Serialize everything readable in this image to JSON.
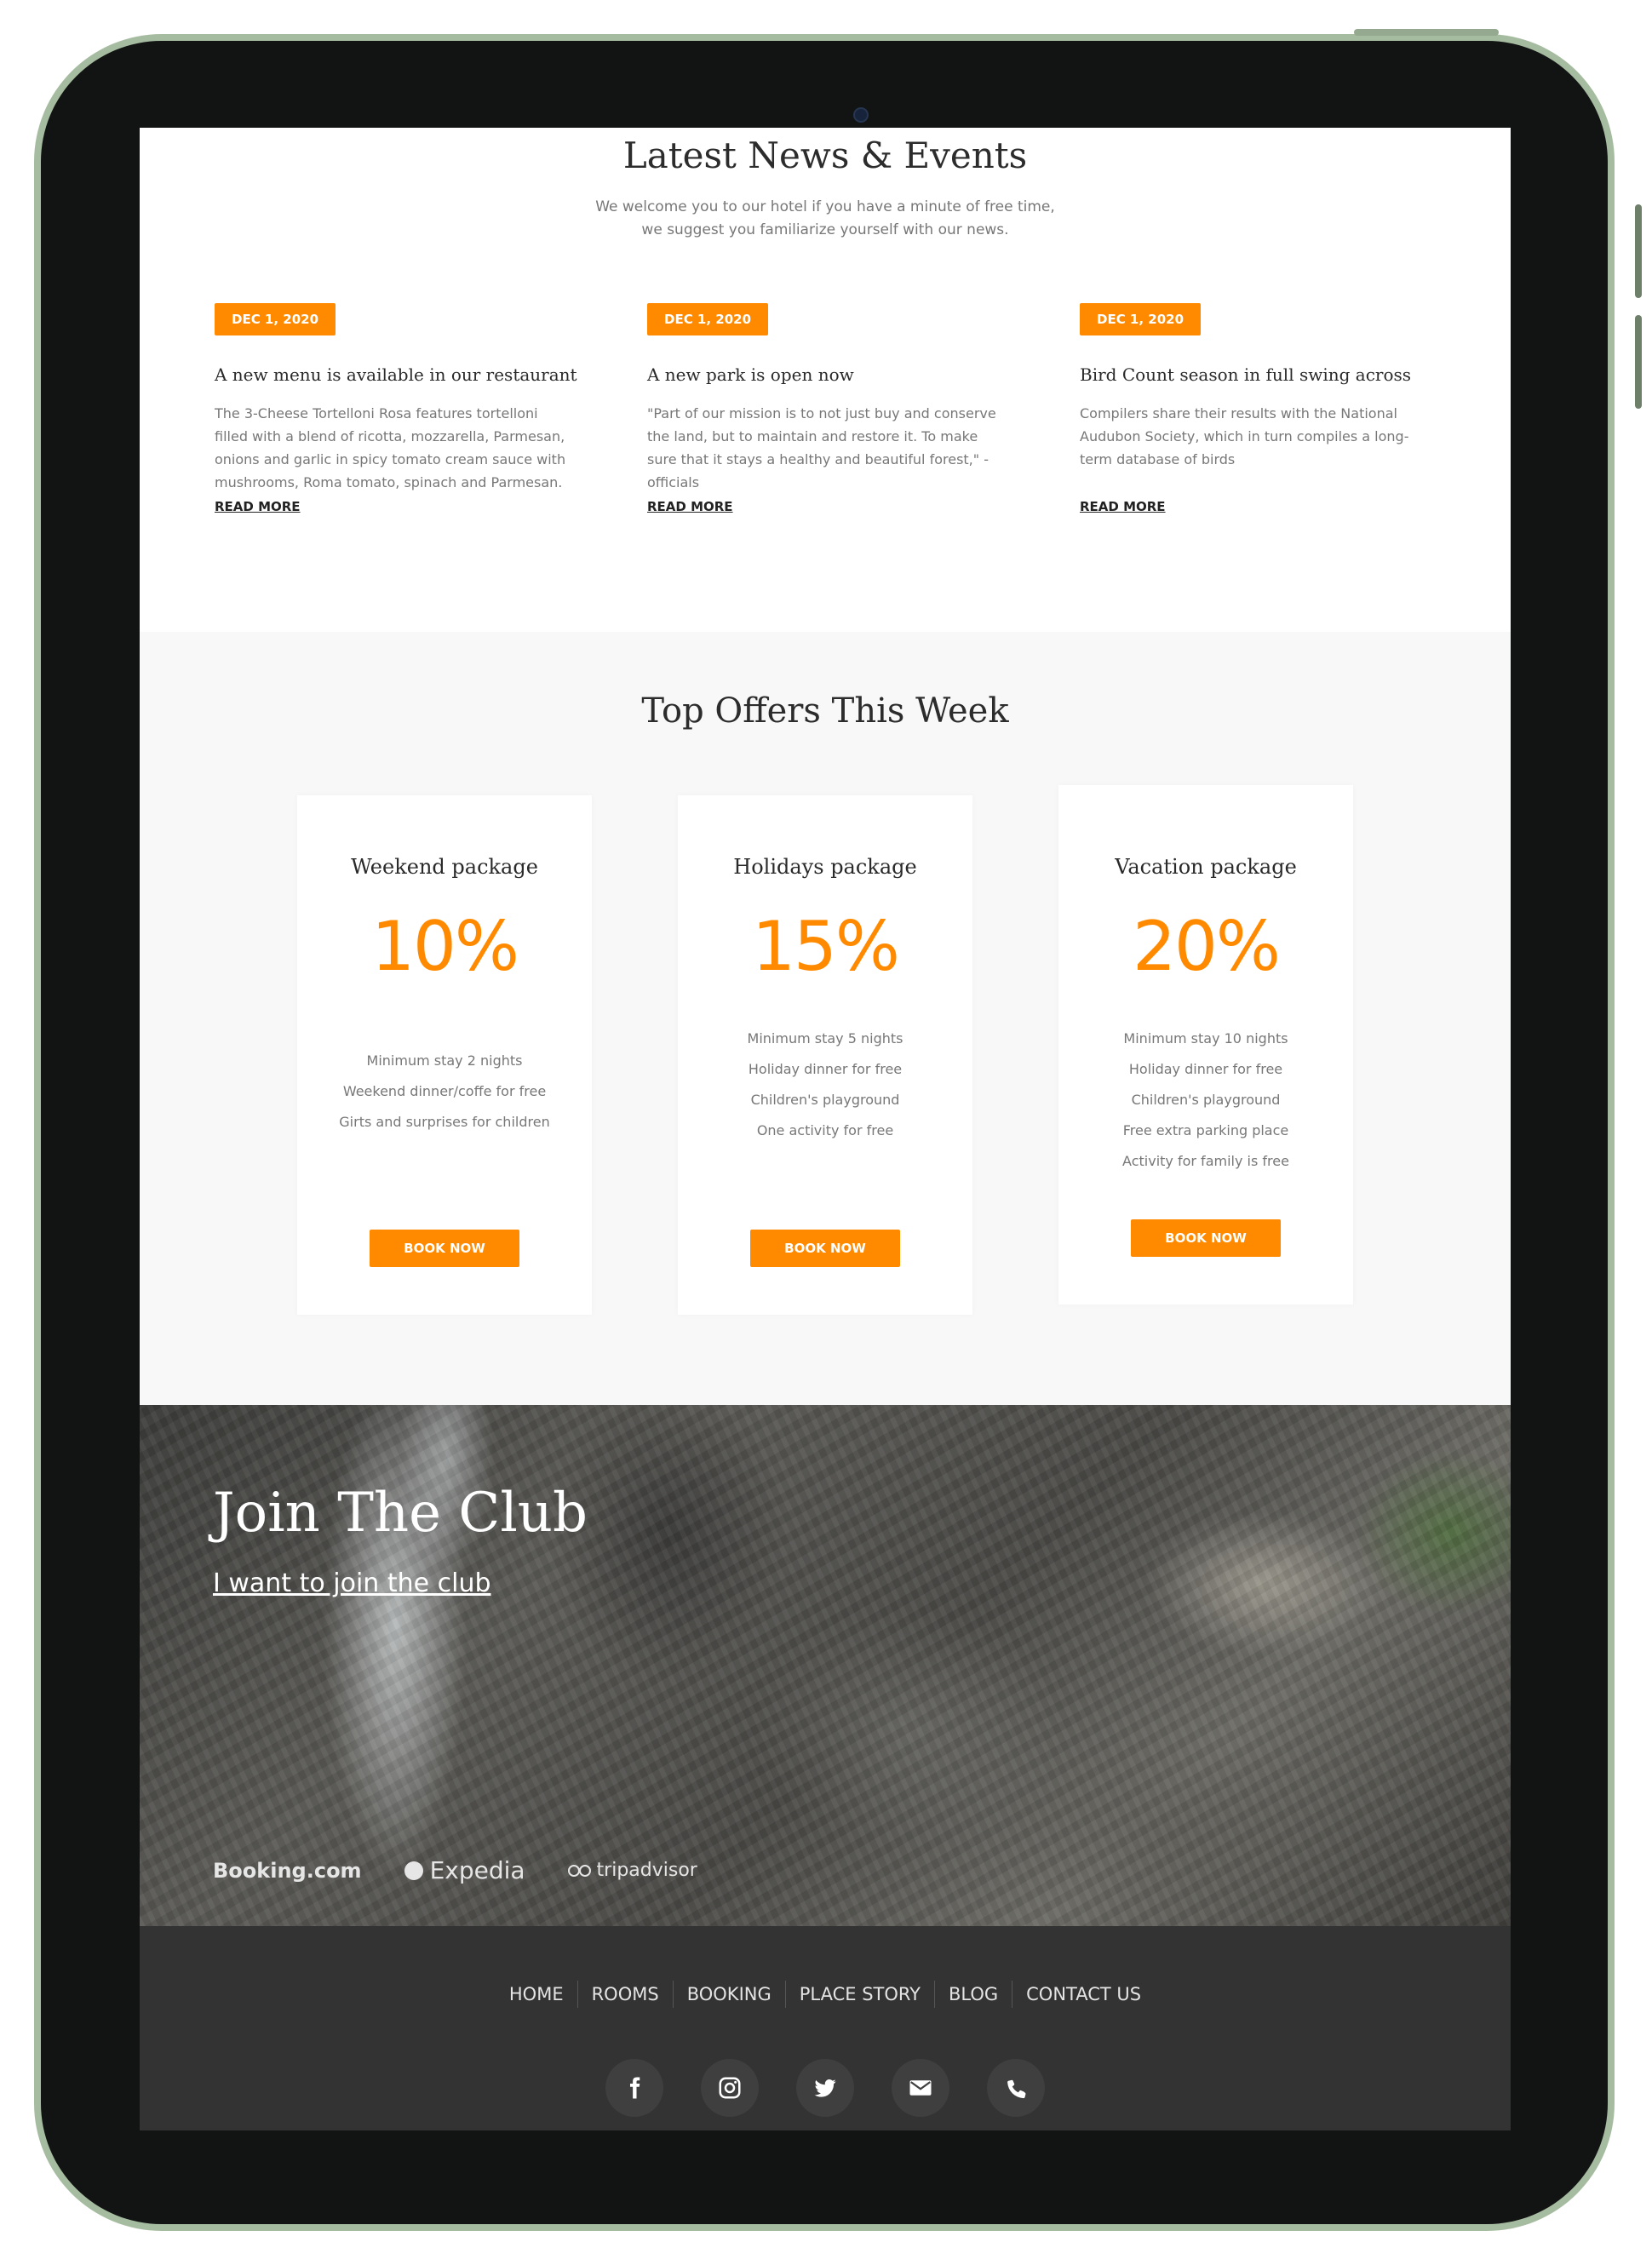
{
  "news": {
    "title": "Latest News & Events",
    "subtitle": "We welcome you to our hotel if you have a minute of free time, we suggest you familiarize yourself with our news.",
    "items": [
      {
        "date": "DEC 1, 2020",
        "headline": "A new menu is available in our restaurant",
        "body": "The 3-Cheese Tortelloni Rosa features tortelloni filled with a blend of ricotta, mozzarella, Parmesan, onions and garlic in spicy tomato cream sauce with mushrooms, Roma tomato, spinach and Parmesan.",
        "read_more": "READ MORE"
      },
      {
        "date": "DEC 1, 2020",
        "headline": "A new park is open now",
        "body": "\"Part of our mission is to not just buy and conserve the land, but to maintain and restore it. To make sure that it stays a healthy and beautiful forest,\" - officials",
        "read_more": "READ MORE"
      },
      {
        "date": "DEC 1, 2020",
        "headline": "Bird Count season in full swing across",
        "body": "Compilers share their results with the National Audubon Society, which in turn compiles a long-term database of birds",
        "read_more": "READ MORE"
      }
    ]
  },
  "offers": {
    "title": "Top Offers This Week",
    "cards": [
      {
        "title": "Weekend package",
        "percent": "10%",
        "features": [
          "Minimum stay 2 nights",
          "Weekend dinner/coffe for free",
          "Girts and surprises for children"
        ],
        "button": "BOOK NOW"
      },
      {
        "title": "Holidays package",
        "percent": "15%",
        "features": [
          "Minimum stay 5 nights",
          "Holiday dinner for free",
          "Children's playground",
          "One activity for free"
        ],
        "button": "BOOK NOW"
      },
      {
        "title": "Vacation package",
        "percent": "20%",
        "features": [
          "Minimum stay 10 nights",
          "Holiday dinner for free",
          "Children's playground",
          "Free extra parking place",
          "Activity for family is free"
        ],
        "button": "BOOK NOW"
      }
    ]
  },
  "club": {
    "title": "Join The Club",
    "link": "I want to join the club",
    "partners": [
      "Booking.com",
      "Expedia",
      "tripadvisor"
    ]
  },
  "footer": {
    "nav": [
      "HOME",
      "ROOMS",
      "BOOKING",
      "PLACE STORY",
      "BLOG",
      "CONTACT US"
    ],
    "socials": [
      "facebook-icon",
      "instagram-icon",
      "twitter-icon",
      "mail-icon",
      "phone-icon"
    ]
  },
  "colors": {
    "accent": "#ff8a00",
    "footer_bg": "#333333",
    "offers_bg": "#f8f8f8",
    "device_frame": "#a6bca0"
  }
}
